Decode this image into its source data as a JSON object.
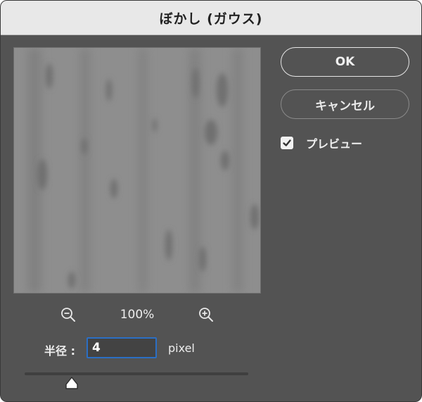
{
  "dialog": {
    "title": "ぼかし (ガウス)"
  },
  "buttons": {
    "ok_label": "OK",
    "cancel_label": "キャンセル"
  },
  "preview_option": {
    "label": "プレビュー",
    "checked": true
  },
  "zoom": {
    "level": "100%",
    "zoom_out_icon": "zoom-out-icon",
    "zoom_in_icon": "zoom-in-icon"
  },
  "radius": {
    "label": "半径 :",
    "value": "4",
    "unit": "pixel",
    "slider_fraction": 0.21
  },
  "colors": {
    "dialog_bg": "#535353",
    "titlebar_bg": "#e8e8e8",
    "focus_ring": "#2b6fc4",
    "text": "#f0f0f0"
  }
}
